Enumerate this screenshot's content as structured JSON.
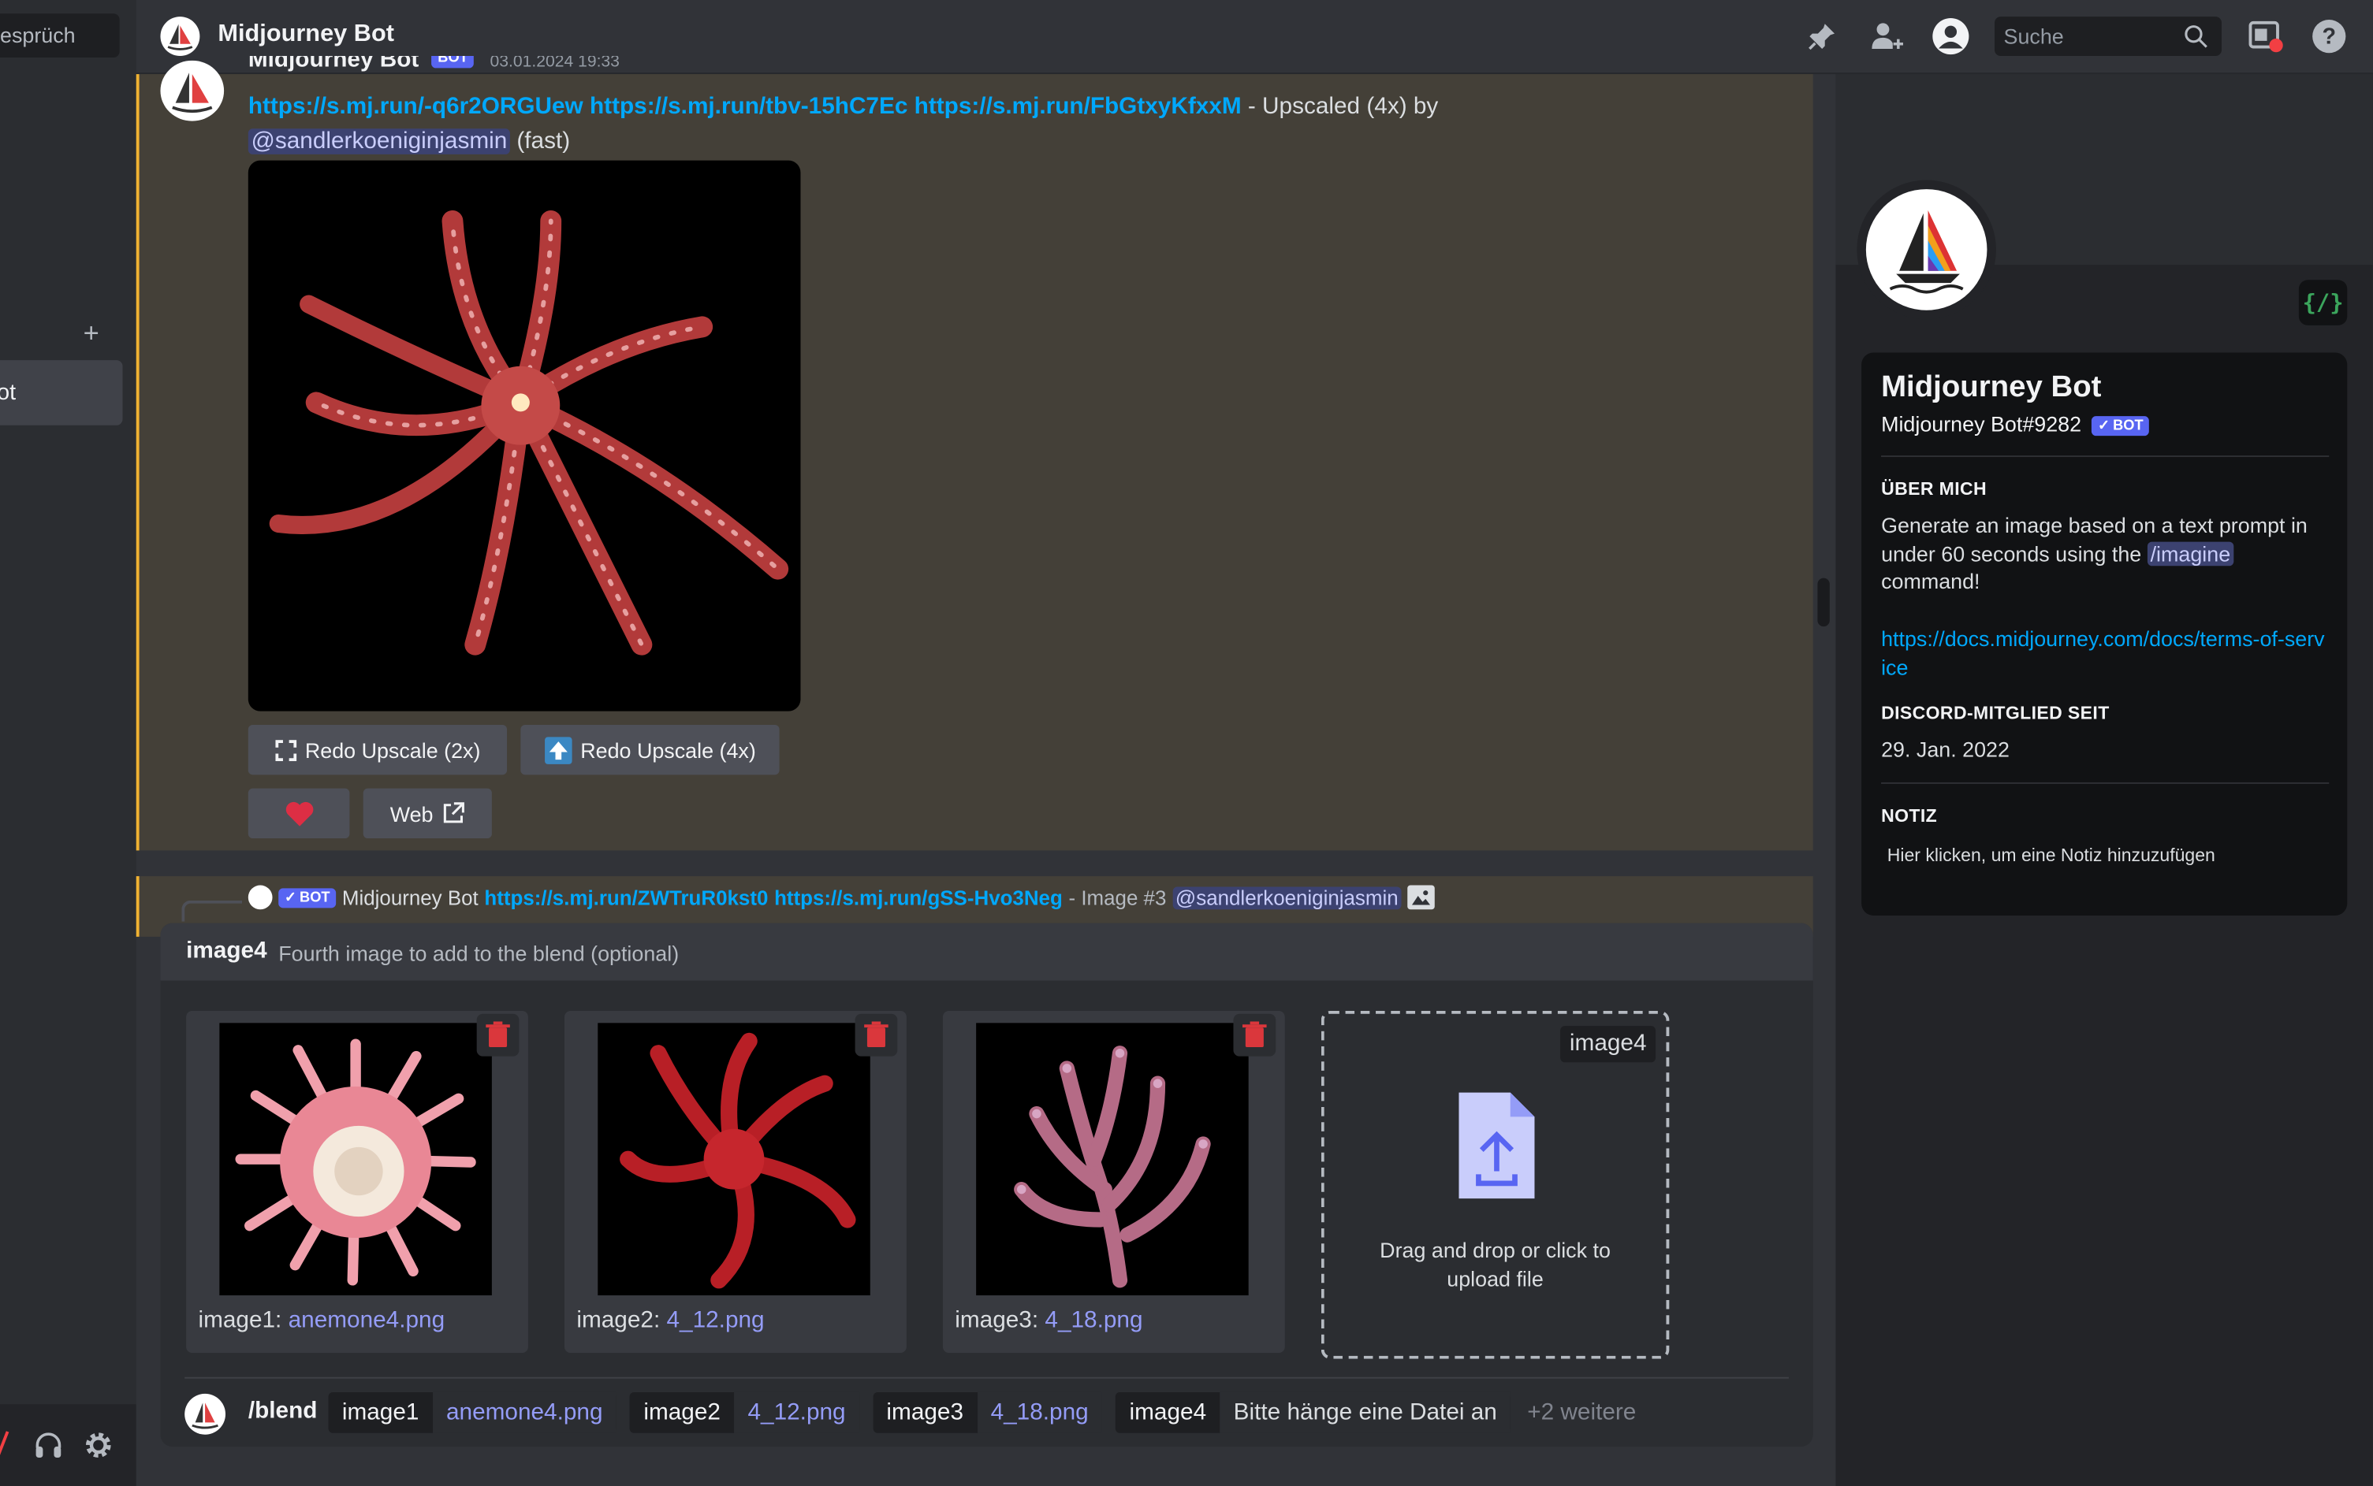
{
  "sidebar": {
    "search_label": "esprüch",
    "dm_item": "ot",
    "add_label": "+"
  },
  "header": {
    "title": "Midjourney Bot",
    "search_placeholder": "Suche"
  },
  "message1": {
    "author": "Midjourney Bot",
    "bot_tag": "BOT",
    "timestamp": "03.01.2024 19:33",
    "link1": "https://s.mj.run/-q6r2ORGUew",
    "link2": "https://s.mj.run/tbv-15hC7Ec",
    "link3": "https://s.mj.run/FbGtxyKfxxM",
    "suffix": " - Upscaled (4x) by",
    "mention": "@sandlerkoeniginjasmin",
    "speed": " (fast)",
    "btn_redo2x": "Redo Upscale (2x)",
    "btn_redo4x": "Redo Upscale (4x)",
    "btn_web": "Web"
  },
  "reply_preview": {
    "bot_tag": "BOT",
    "author": "Midjourney Bot",
    "link1": "https://s.mj.run/ZWTruR0kst0",
    "link2": "https://s.mj.run/gSS-Hvo3Neg",
    "suffix": " - Image #3",
    "mention": "@sandlerkoeniginjasmin"
  },
  "blend_modal": {
    "option_name": "image4",
    "option_desc": "Fourth image to add to the blend (optional)",
    "cards": [
      {
        "label": "image1: ",
        "file": "anemone4.png"
      },
      {
        "label": "image2: ",
        "file": "4_12.png"
      },
      {
        "label": "image3: ",
        "file": "4_18.png"
      }
    ],
    "dropzone_tag": "image4",
    "dropzone_text": "Drag and drop or click to upload file"
  },
  "command_bar": {
    "command": "/blend",
    "params": [
      {
        "key": "image1",
        "value": "anemone4.png"
      },
      {
        "key": "image2",
        "value": "4_12.png"
      },
      {
        "key": "image3",
        "value": "4_18.png"
      },
      {
        "key": "image4",
        "value": "Bitte hänge eine Datei an"
      }
    ],
    "more": "+2 weitere"
  },
  "profile": {
    "name": "Midjourney Bot",
    "tag": "Midjourney Bot#9282",
    "bot_tag": "BOT",
    "about_title": "ÜBER MICH",
    "about_text_1": "Generate an image based on a text prompt in under 60 seconds using the ",
    "about_cmd": "/imagine",
    "about_text_2": " command!",
    "about_link": "https://docs.midjourney.com/docs/terms-of-service",
    "member_title": "DISCORD-MITGLIED SEIT",
    "member_since": "29. Jan. 2022",
    "note_title": "NOTIZ",
    "note_placeholder": "Hier klicken, um eine Notiz hinzuzufügen"
  },
  "colors": {
    "accent": "#5865f2",
    "link": "#00a8fc",
    "highlight": "#f0b232",
    "danger": "#da373c"
  }
}
